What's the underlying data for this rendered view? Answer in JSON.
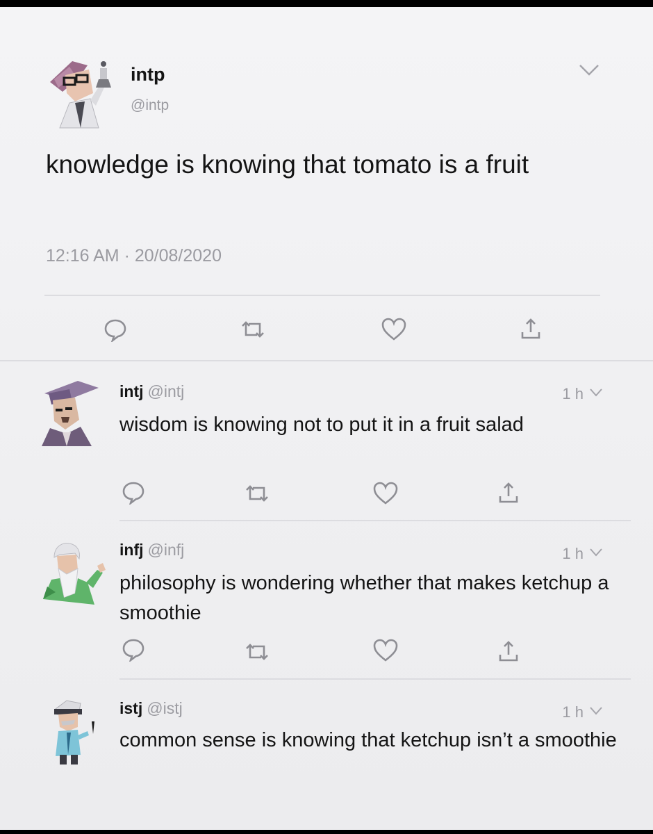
{
  "main_tweet": {
    "name": "intp",
    "handle": "@intp",
    "text": "knowledge is knowing that tomato is a fruit",
    "timestamp": "12:16 AM · 20/08/2020",
    "avatar_icon": "scientist-avatar-icon",
    "actions": [
      "reply-icon",
      "retweet-icon",
      "like-icon",
      "share-icon"
    ]
  },
  "replies": [
    {
      "name": "intj",
      "handle": "@intj",
      "time": "1 h",
      "text": "wisdom is knowing not to put it in a fruit salad",
      "avatar_icon": "professor-avatar-icon"
    },
    {
      "name": "infj",
      "handle": "@infj",
      "time": "1 h",
      "text": "philosophy is wondering whether that makes ketchup a smoothie",
      "avatar_icon": "sage-avatar-icon"
    },
    {
      "name": "istj",
      "handle": "@istj",
      "time": "1 h",
      "text": "common sense is knowing that ketchup isn’t a smoothie",
      "avatar_icon": "inspector-avatar-icon"
    }
  ],
  "colors": {
    "background": "#f0f0f2",
    "text": "#141414",
    "secondary_text": "#9b9ba1",
    "icon": "#8e8e94",
    "divider": "#dcdce0"
  }
}
